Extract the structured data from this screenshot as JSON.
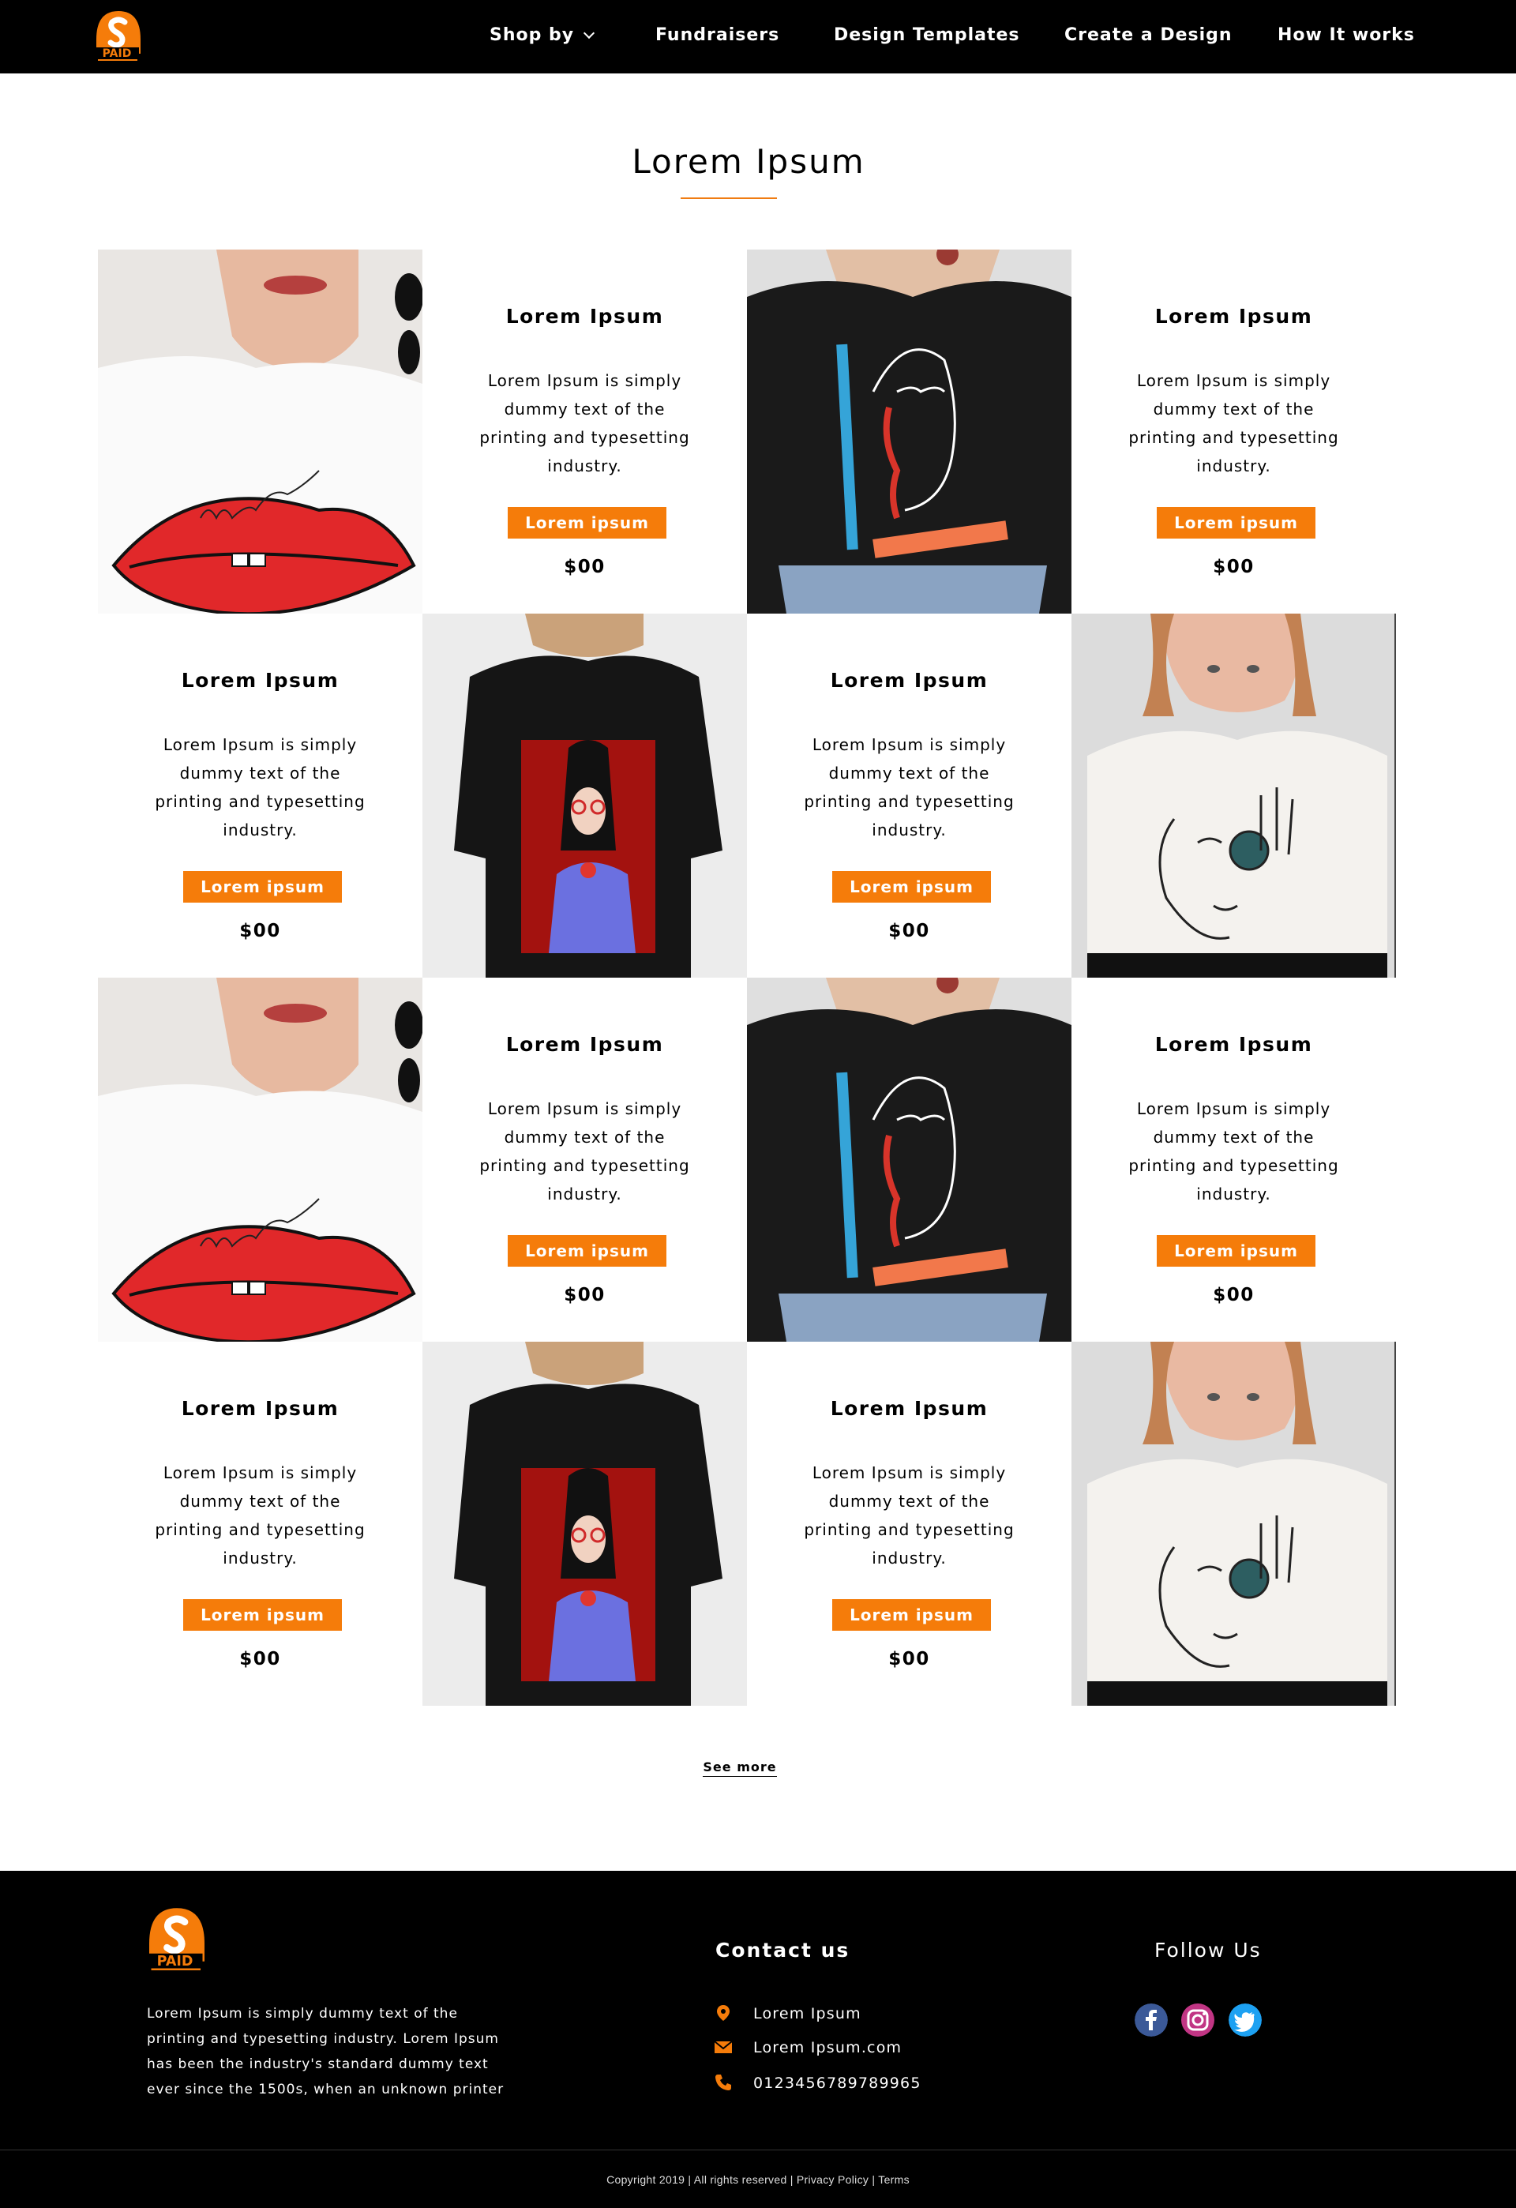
{
  "nav": {
    "items": [
      {
        "label": "Shop by",
        "has_dropdown": true
      },
      {
        "label": "Fundraisers"
      },
      {
        "label": "Design Templates"
      },
      {
        "label": "Create a Design"
      },
      {
        "label": "How It works"
      }
    ]
  },
  "section": {
    "title": "Lorem Ipsum"
  },
  "products": {
    "p1": {
      "title": "Lorem Ipsum",
      "desc": "Lorem Ipsum is simply dummy text of the printing and typesetting industry.",
      "button": "Lorem ipsum",
      "price": "$00"
    },
    "p2": {
      "title": "Lorem Ipsum",
      "desc": "Lorem Ipsum is simply dummy text of the printing and typesetting industry.",
      "button": "Lorem ipsum",
      "price": "$00"
    },
    "p3": {
      "title": "Lorem Ipsum",
      "desc": "Lorem Ipsum is simply dummy text of the printing and typesetting industry.",
      "button": "Lorem ipsum",
      "price": "$00"
    },
    "p4": {
      "title": "Lorem Ipsum",
      "desc": "Lorem Ipsum is simply dummy text of the printing and typesetting industry.",
      "button": "Lorem ipsum",
      "price": "$00"
    },
    "p5": {
      "title": "Lorem Ipsum",
      "desc": "Lorem Ipsum is simply dummy text of the printing and typesetting industry.",
      "button": "Lorem ipsum",
      "price": "$00"
    },
    "p6": {
      "title": "Lorem Ipsum",
      "desc": "Lorem Ipsum is simply dummy text of the printing and typesetting industry.",
      "button": "Lorem ipsum",
      "price": "$00"
    },
    "p7": {
      "title": "Lorem Ipsum",
      "desc": "Lorem Ipsum is simply dummy text of the printing and typesetting industry.",
      "button": "Lorem ipsum",
      "price": "$00"
    },
    "p8": {
      "title": "Lorem Ipsum",
      "desc": "Lorem Ipsum is simply dummy text of the printing and typesetting industry.",
      "button": "Lorem ipsum",
      "price": "$00"
    }
  },
  "see_more": "See more",
  "footer": {
    "about": "Lorem Ipsum is simply dummy text of the printing and typesetting industry. Lorem Ipsum has been the industry's standard dummy text ever since the 1500s, when an unknown printer",
    "contact_title": "Contact us",
    "contact": {
      "address": "Lorem Ipsum",
      "email": "Lorem Ipsum.com",
      "phone": "0123456789789965"
    },
    "follow_title": "Follow Us",
    "social": [
      "facebook-icon",
      "instagram-icon",
      "twitter-icon"
    ],
    "copyright": "Copyright 2019 | All rights reserved | ",
    "privacy": "Privacy Policy",
    "sep": " | ",
    "terms": "Terms"
  },
  "colors": {
    "accent": "#f57c0a",
    "nav_bg": "#000000",
    "footer_bg": "#000000"
  }
}
